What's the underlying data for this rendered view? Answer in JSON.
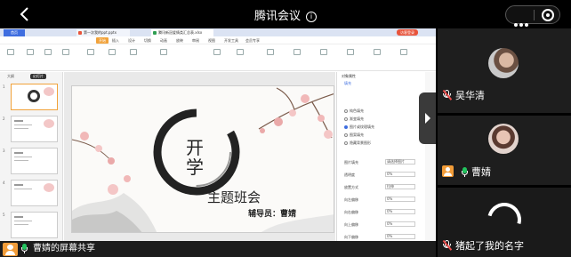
{
  "meeting": {
    "title": "腾讯会议"
  },
  "wps": {
    "tabs": [
      "首页",
      "第一次我的ppt.pptx",
      "腾讯新冠爱情类汇总表.xlsx"
    ],
    "menu": [
      "开始",
      "插入",
      "设计",
      "切换",
      "动画",
      "放映",
      "审阅",
      "视图",
      "开发工具",
      "会员专享"
    ],
    "user_badge": "访客登录",
    "left_tabs": [
      "大纲",
      "幻灯片"
    ],
    "thumb_numbers": [
      "1",
      "2",
      "3",
      "4",
      "5"
    ],
    "right_title": "对象属性",
    "right_tab": "填充",
    "right_options": [
      "纯色填充",
      "渐变填充",
      "图片或纹理填充",
      "图案填充",
      "隐藏背景图形"
    ],
    "right_fields": [
      "图片填充",
      "透明度",
      "放置方式",
      "向左偏移",
      "向右偏移",
      "向上偏移",
      "向下偏移"
    ],
    "right_values": [
      "请选择图片",
      "0%",
      "拉伸",
      "0%",
      "0%",
      "0%",
      "0%"
    ]
  },
  "slide": {
    "kai": "开学",
    "topic": "主题班会",
    "teacher": "辅导员：曹婧"
  },
  "share": {
    "label": "曹婧的屏幕共享"
  },
  "participants": [
    {
      "name": "吴华清",
      "mic": "muted"
    },
    {
      "name": "曹婧",
      "mic": "active"
    },
    {
      "name": "猪起了我的名字",
      "mic": "muted"
    }
  ],
  "colors": {
    "background": "#000000",
    "mic_active": "#22c35e",
    "mic_muted_slash": "#e94c4c",
    "avatar_orange": "#f29c38",
    "wps_accent": "#f1a23a"
  }
}
